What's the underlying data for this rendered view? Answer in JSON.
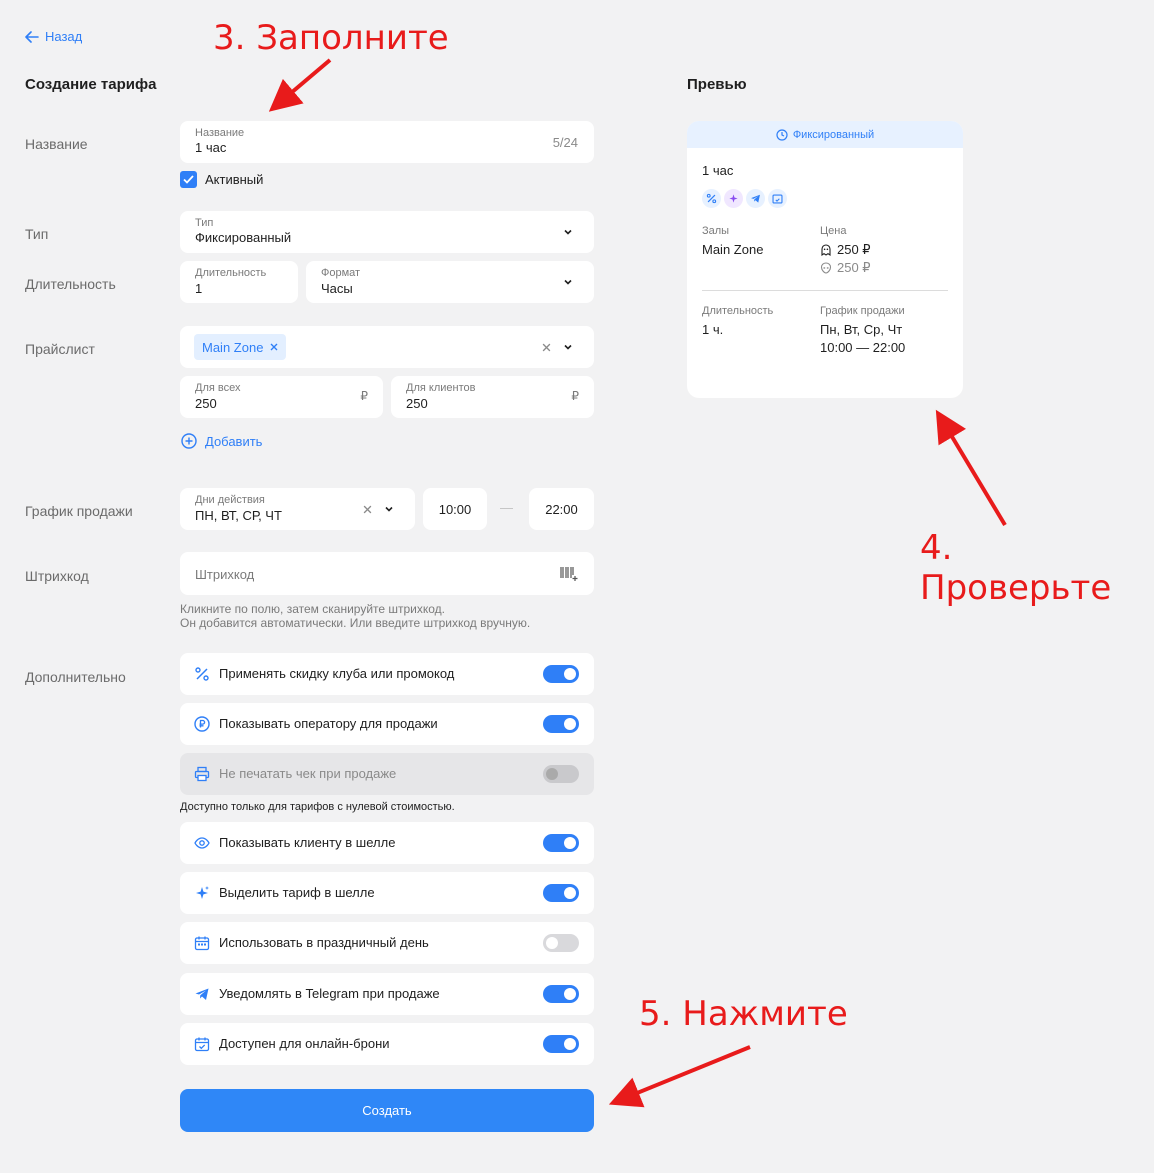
{
  "nav": {
    "back_label": "Назад"
  },
  "page_title": "Создание тарифа",
  "preview_title": "Превью",
  "labels": {
    "name": "Название",
    "type": "Тип",
    "duration": "Длительность",
    "pricelist": "Прайслист",
    "schedule": "График продажи",
    "barcode": "Штрихкод",
    "extra": "Дополнительно"
  },
  "name_field": {
    "label": "Название",
    "value": "1 час",
    "counter": "5/24"
  },
  "active_checkbox": {
    "label": "Активный",
    "checked": true
  },
  "type_field": {
    "label": "Тип",
    "value": "Фиксированный"
  },
  "duration_field": {
    "label": "Длительность",
    "value": "1"
  },
  "format_field": {
    "label": "Формат",
    "value": "Часы"
  },
  "pricelist": {
    "tag": "Main Zone",
    "all_label": "Для всех",
    "all_value": "250",
    "clients_label": "Для клиентов",
    "clients_value": "250",
    "currency": "₽",
    "add_label": "Добавить"
  },
  "schedule": {
    "days_label": "Дни действия",
    "days_value": "ПН, ВТ, СР, ЧТ",
    "from": "10:00",
    "dash": "—",
    "to": "22:00"
  },
  "barcode": {
    "placeholder": "Штрихкод",
    "hint_line1": "Кликните по полю, затем сканируйте штрихкод.",
    "hint_line2": "Он добавится автоматически. Или введите штрихкод вручную."
  },
  "options": [
    {
      "label": "Применять скидку клуба или промокод",
      "icon": "percent-icon",
      "on": true
    },
    {
      "label": "Показывать оператору для продажи",
      "icon": "ruble-icon",
      "on": true
    },
    {
      "label": "Не печатать чек при продаже",
      "icon": "printer-icon",
      "on": false,
      "disabled": true
    },
    {
      "label": "Показывать клиенту в шелле",
      "icon": "eye-icon",
      "on": true
    },
    {
      "label": "Выделить тариф в шелле",
      "icon": "sparkle-icon",
      "on": true
    },
    {
      "label": "Использовать в праздничный день",
      "icon": "calendar-icon",
      "on": false
    },
    {
      "label": "Уведомлять в Telegram при продаже",
      "icon": "telegram-icon",
      "on": true
    },
    {
      "label": "Доступен для онлайн-брони",
      "icon": "calendar-check-icon",
      "on": true
    }
  ],
  "disabled_note": "Доступно только для тарифов с нулевой стоимостью.",
  "create_button": "Создать",
  "preview": {
    "badge": "Фиксированный",
    "name": "1 час",
    "halls_label": "Залы",
    "halls_value": "Main Zone",
    "price_label": "Цена",
    "price_all": "250 ₽",
    "price_clients": "250 ₽",
    "duration_label": "Длительность",
    "duration_value": "1 ч.",
    "schedule_label": "График продажи",
    "schedule_days": "Пн, Вт, Ср, Чт",
    "schedule_time": "10:00 — 22:00"
  },
  "annotations": {
    "step3": "3. Заполните",
    "step4": "4. Проверьте",
    "step5": "5. Нажмите"
  },
  "colors": {
    "accent": "#2f7ff7",
    "annotation": "#e81b1b",
    "background": "#f2f2f3"
  }
}
